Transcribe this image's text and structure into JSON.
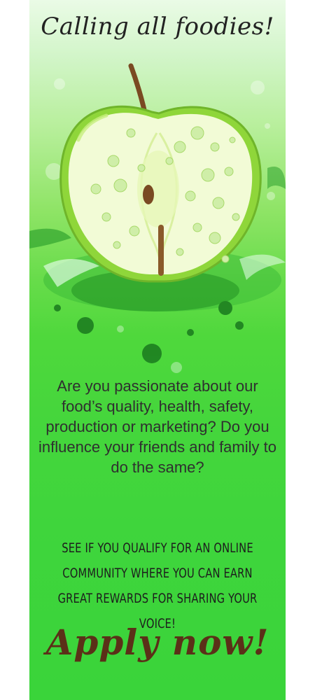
{
  "banner": {
    "headline": "Calling all foodies!",
    "body": "Are you passionate about our food’s quality, health, safety, production or marketing? Do you influence your friends and family to do the same?",
    "cta": "See if you qualify for an online community where you can earn great rewards for sharing your voice!",
    "apply_label": "Apply now!"
  },
  "icons": [
    "apple-illustration-icon",
    "water-droplet-icon",
    "paint-splash-icon"
  ],
  "colors": {
    "background_top": "#eafbe6",
    "background_bottom": "#3ad43a",
    "apple_green": "#8fd63a",
    "apple_flesh": "#f2fbd6",
    "apply_text": "#5b3018"
  }
}
